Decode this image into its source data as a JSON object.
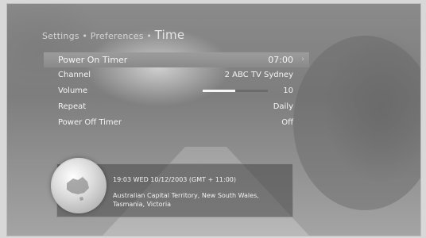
{
  "breadcrumb": {
    "path": "Settings • Preferences • ",
    "current": "Time"
  },
  "menu": {
    "items": [
      {
        "label": "Power On Timer",
        "value": "07:00"
      },
      {
        "label": "Channel",
        "value": "2 ABC TV Sydney"
      },
      {
        "label": "Volume",
        "value": "10",
        "level_fraction": 0.5
      },
      {
        "label": "Repeat",
        "value": "Daily"
      },
      {
        "label": "Power Off Timer",
        "value": "Off"
      }
    ],
    "selected_arrow": "›"
  },
  "info": {
    "datetime": "19:03 WED 10/12/2003 (GMT + 11:00)",
    "region": "Australian Capital Territory, New South Wales, Tasmania, Victoria",
    "globe_icon": "globe-icon"
  }
}
